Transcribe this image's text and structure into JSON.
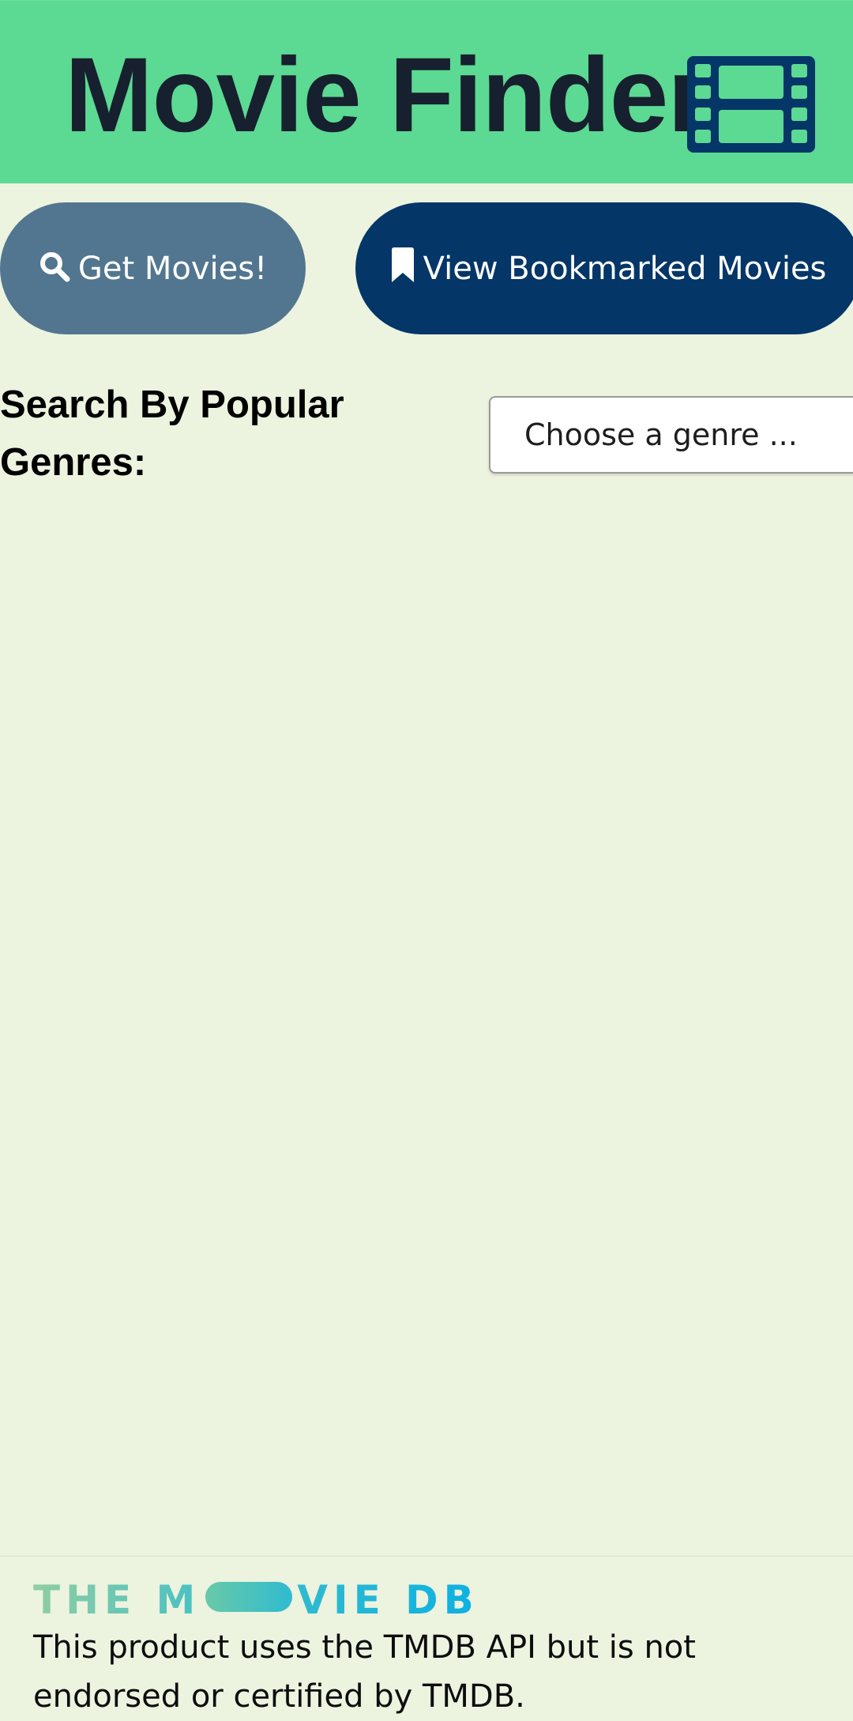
{
  "header": {
    "title": "Movie Finder",
    "icon": "film-icon",
    "background": "#5cd993",
    "title_color": "#17202e",
    "icon_color": "#043668"
  },
  "actions": {
    "get_movies": {
      "label": "Get Movies!",
      "icon": "search-icon",
      "color": "#52768f"
    },
    "bookmarks": {
      "label": "View Bookmarked Movies",
      "icon": "bookmark-icon",
      "color": "#043668"
    }
  },
  "genre_search": {
    "label": "Search By Popular Genres:",
    "select_value": "Choose a genre ..."
  },
  "footer": {
    "logo_text_left": "THE M",
    "logo_text_right": "VIE DB",
    "disclaimer": "This product uses the TMDB API but is not endorsed or certified by TMDB."
  },
  "page_background": "#ecf3df"
}
